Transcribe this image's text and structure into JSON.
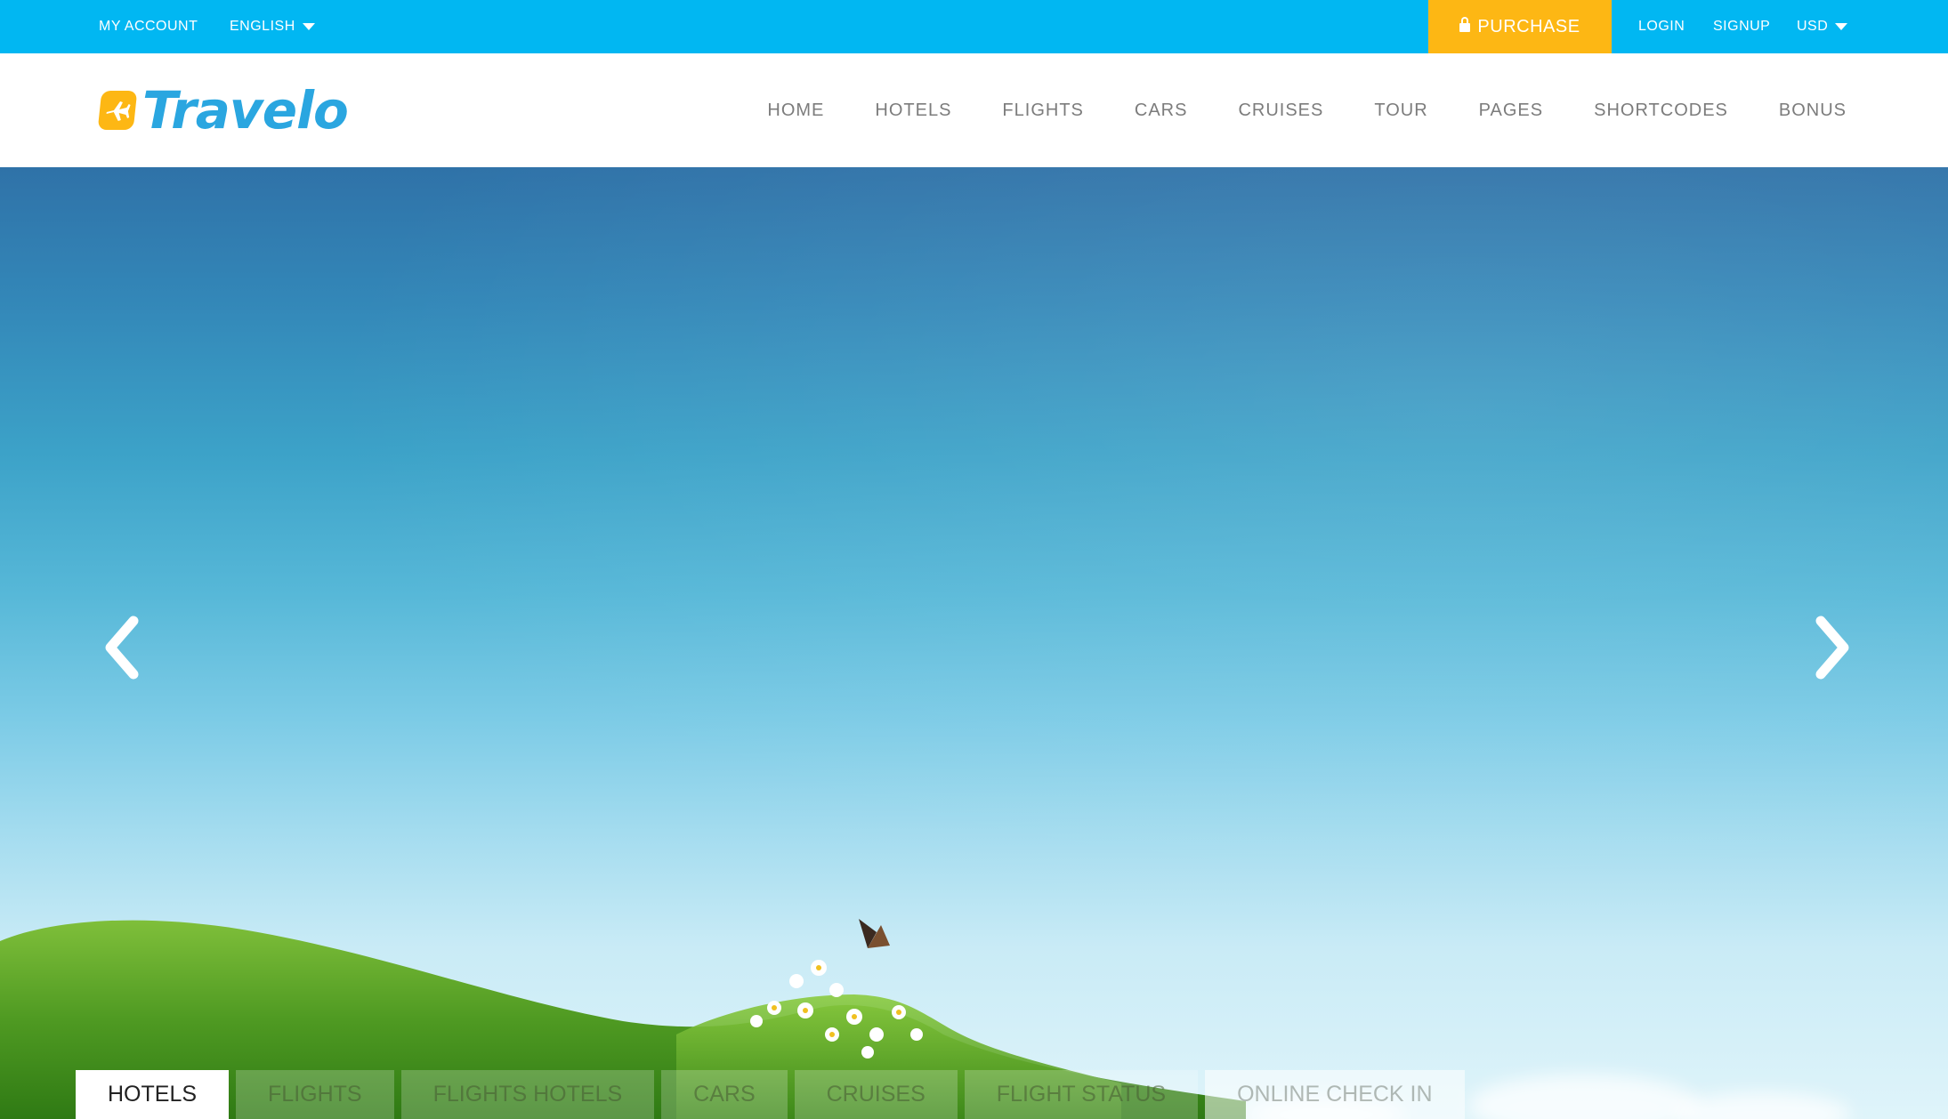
{
  "topbar": {
    "my_account": "MY ACCOUNT",
    "language": "ENGLISH",
    "purchase": "PURCHASE",
    "login": "LOGIN",
    "signup": "SIGNUP",
    "currency": "USD",
    "bg_color": "#01b7f2",
    "purchase_color": "#fdb714"
  },
  "header": {
    "logo_text": "Travelo",
    "nav": [
      "HOME",
      "HOTELS",
      "FLIGHTS",
      "CARS",
      "CRUISES",
      "TOUR",
      "PAGES",
      "SHORTCODES",
      "BONUS"
    ]
  },
  "hero": {
    "prev_icon": "chevron-left-icon",
    "next_icon": "chevron-right-icon"
  },
  "search_tabs": {
    "items": [
      "HOTELS",
      "FLIGHTS",
      "FLIGHTS HOTELS",
      "CARS",
      "CRUISES",
      "FLIGHT STATUS",
      "ONLINE CHECK IN"
    ],
    "active_index": 0
  }
}
